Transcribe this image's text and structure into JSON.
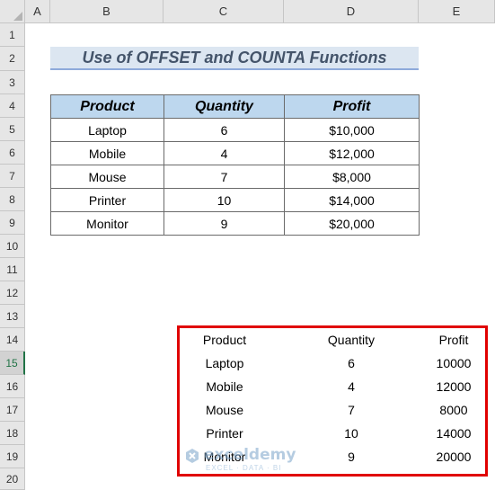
{
  "columns": [
    "A",
    "B",
    "C",
    "D",
    "E"
  ],
  "rows": [
    "1",
    "2",
    "3",
    "4",
    "5",
    "6",
    "7",
    "8",
    "9",
    "10",
    "11",
    "12",
    "13",
    "14",
    "15",
    "16",
    "17",
    "18",
    "19",
    "20"
  ],
  "active_row": "15",
  "title": "Use of OFFSET and COUNTA Functions",
  "source_table": {
    "headers": [
      "Product",
      "Quantity",
      "Profit"
    ],
    "rows": [
      [
        "Laptop",
        "6",
        "$10,000"
      ],
      [
        "Mobile",
        "4",
        "$12,000"
      ],
      [
        "Mouse",
        "7",
        "$8,000"
      ],
      [
        "Printer",
        "10",
        "$14,000"
      ],
      [
        "Monitor",
        "9",
        "$20,000"
      ]
    ]
  },
  "result_table": {
    "headers": [
      "Product",
      "Quantity",
      "Profit"
    ],
    "rows": [
      [
        "Laptop",
        "6",
        "10000"
      ],
      [
        "Mobile",
        "4",
        "12000"
      ],
      [
        "Mouse",
        "7",
        "8000"
      ],
      [
        "Printer",
        "10",
        "14000"
      ],
      [
        "Monitor",
        "9",
        "20000"
      ]
    ]
  },
  "watermark": {
    "name": "exceldemy",
    "tagline": "EXCEL · DATA · BI"
  },
  "colors": {
    "header_fill": "#bdd7ee",
    "title_fill": "#dce6f1",
    "title_text": "#44546a",
    "highlight_border": "#e00000",
    "active_row": "#217346"
  }
}
